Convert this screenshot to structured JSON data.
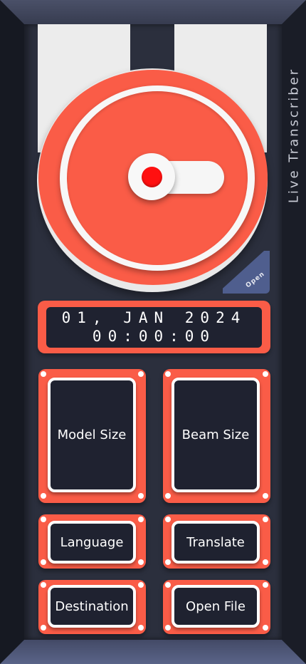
{
  "app": {
    "title": "Live Transcriber"
  },
  "datetime": {
    "date": "01, JAN 2024",
    "time": "00:00:00"
  },
  "record": {
    "state": "idle"
  },
  "open_tab": {
    "label": "Open"
  },
  "buttons": {
    "model_size": "Model Size",
    "beam_size": "Beam Size",
    "language": "Language",
    "translate": "Translate",
    "destination": "Destination",
    "open_file": "Open File"
  },
  "colors": {
    "accent": "#fa5c47",
    "panel": "#2b2f3d",
    "screen": "#1f2230",
    "record_dot": "#ff1010",
    "open_tab": "#4f5e8e"
  }
}
